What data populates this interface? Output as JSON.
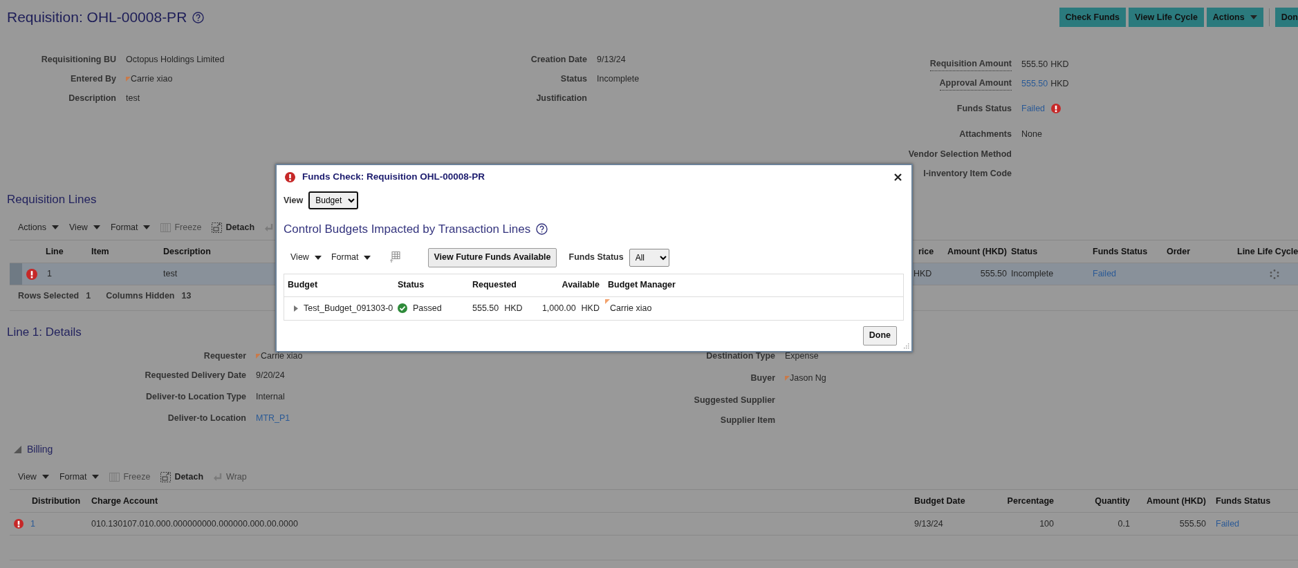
{
  "page": {
    "title": "Requisition: OHL-00008-PR",
    "buttons": [
      {
        "label": "Check Funds",
        "kind": "plain"
      },
      {
        "label": "View Life Cycle",
        "kind": "plain"
      },
      {
        "label": "Actions",
        "kind": "menu"
      },
      {
        "label": "Don",
        "kind": "plain"
      }
    ]
  },
  "header": {
    "column_1": [
      {
        "label": "Requisitioning BU",
        "value": "Octopus Holdings Limited"
      },
      {
        "label": "Entered By",
        "value": "Carrie xiao",
        "person": true
      },
      {
        "label": "Description",
        "value": "test"
      }
    ],
    "column_2": [
      {
        "label": "Creation Date",
        "value": "9/13/24"
      },
      {
        "label": "Status",
        "value": "Incomplete"
      },
      {
        "label": "Justification"
      }
    ],
    "column_3": [
      {
        "label": "Requisition Amount",
        "value": "555.50",
        "unit": "HKD",
        "dotted": true
      },
      {
        "label": "Approval Amount",
        "value": "555.50",
        "unit": "HKD",
        "dotted": true,
        "link": true
      },
      {
        "label": "Funds Status",
        "value": "Failed",
        "link": true,
        "error": true
      },
      {
        "label": "Attachments",
        "value": "None"
      },
      {
        "label": "Vendor Selection Method"
      },
      {
        "label": "I-inventory Item Code"
      }
    ]
  },
  "lines": {
    "title": "Requisition Lines",
    "toolbar": [
      {
        "kind": "menu",
        "label": "Actions",
        "disabled": false
      },
      {
        "kind": "menu",
        "label": "View",
        "disabled": false
      },
      {
        "kind": "menu",
        "label": "Format",
        "disabled": false
      },
      {
        "kind": "freeze",
        "label": "Freeze",
        "disabled": true
      },
      {
        "kind": "detach",
        "label": "Detach",
        "disabled": false
      },
      {
        "kind": "wrap",
        "disabled": true
      }
    ],
    "columns": [
      {
        "label": "Line"
      },
      {
        "label": "Item"
      },
      {
        "label": "Description"
      },
      {
        "label": "rice"
      },
      {
        "label": "Amount (HKD)"
      },
      {
        "label": "Status"
      },
      {
        "label": "Funds Status"
      },
      {
        "label": "Order"
      },
      {
        "label": "Line Life Cycle"
      }
    ],
    "rows": [
      {
        "selected": true,
        "error": true,
        "cells": [
          "1",
          null,
          "test",
          "HKD",
          "555.50",
          "Incomplete",
          "Failed",
          null,
          null
        ],
        "life_cycle": true
      }
    ],
    "footer": [
      {
        "label": "Rows Selected",
        "value": "1"
      },
      {
        "label": "Columns Hidden",
        "value": "13"
      }
    ]
  },
  "details": {
    "title": "Line 1: Details",
    "column_1": [
      {
        "label": "Requester",
        "value": "Carrie xiao",
        "person": true
      },
      {
        "label": "Requested Delivery Date",
        "value": "9/20/24"
      },
      {
        "label": "Deliver-to Location Type",
        "value": "Internal"
      },
      {
        "label": "Deliver-to Location",
        "value": "MTR_P1",
        "link": true
      }
    ],
    "column_2": [
      {
        "label": "Destination Type",
        "value": "Expense"
      },
      {
        "label": "Buyer",
        "value": "Jason Ng",
        "person": true
      },
      {
        "label": "Suggested Supplier"
      },
      {
        "label": "Supplier Item"
      }
    ]
  },
  "billing": {
    "title": "Billing",
    "expanded": true,
    "toolbar": [
      {
        "kind": "menu",
        "label": "View",
        "disabled": false
      },
      {
        "kind": "menu",
        "label": "Format",
        "disabled": false
      },
      {
        "kind": "freeze",
        "label": "Freeze",
        "disabled": true
      },
      {
        "kind": "detach",
        "label": "Detach",
        "disabled": false
      },
      {
        "kind": "wrap",
        "label": "Wrap",
        "disabled": true
      }
    ],
    "columns": [
      {
        "label": "Distribution"
      },
      {
        "label": "Charge Account"
      },
      {
        "label": "Budget Date"
      },
      {
        "label": "Percentage"
      },
      {
        "label": "Quantity"
      },
      {
        "label": "Amount (HKD)"
      },
      {
        "label": "Funds Status"
      }
    ],
    "rows": [
      {
        "error": true,
        "cells": [
          "1",
          "010.130107.010.000.000000000.000000.000.00.0000",
          "9/13/24",
          "100",
          "0.1",
          "555.50",
          "Failed"
        ]
      }
    ]
  },
  "dialog": {
    "title": "Funds Check: Requisition OHL-00008-PR",
    "error": true,
    "view": {
      "label": "View",
      "value": "Budget"
    },
    "heading": "Control Budgets Impacted by Transaction Lines",
    "toolbar": [
      {
        "kind": "menu",
        "label": "View"
      },
      {
        "kind": "menu",
        "label": "Format"
      },
      {
        "kind": "export"
      }
    ],
    "future_button": "View Future Funds Available",
    "funds_filter": {
      "label": "Funds Status",
      "value": "All"
    },
    "columns": [
      {
        "label": "Budget"
      },
      {
        "label": "Status"
      },
      {
        "label": "Requested"
      },
      {
        "label": "Available"
      },
      {
        "label": "Budget Manager"
      }
    ],
    "rows": [
      {
        "expanded": false,
        "budget": "Test_Budget_091303-0",
        "status": "Passed",
        "passed": true,
        "requested": "555.50",
        "requested_unit": "HKD",
        "available": "1,000.00",
        "available_unit": "HKD",
        "manager": "Carrie xiao"
      }
    ],
    "done": "Done"
  }
}
